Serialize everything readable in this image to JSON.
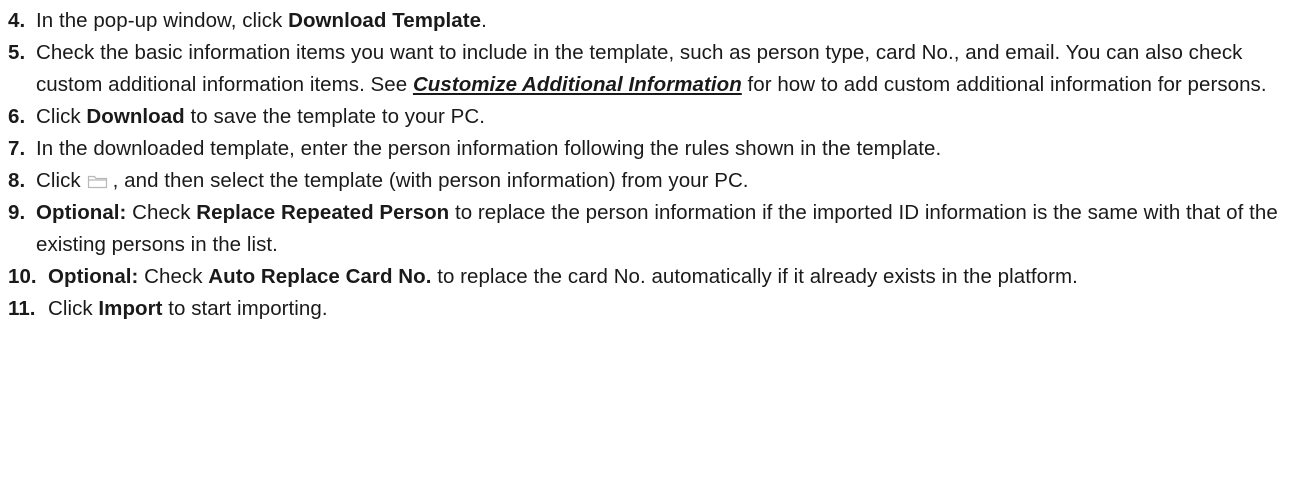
{
  "steps": [
    {
      "num": "4.",
      "t1": "In the pop-up window, click ",
      "b1": "Download Template",
      "t2": "."
    },
    {
      "num": "5.",
      "t1": "Check the basic information items you want to include in the template, such as person type, card No., and email. You can also check custom additional information items. See ",
      "link": "Customize Additional Information",
      "t2": " for how to add custom additional information for persons."
    },
    {
      "num": "6.",
      "t1": "Click ",
      "b1": "Download",
      "t2": " to save the template to your PC."
    },
    {
      "num": "7.",
      "t1": "In the downloaded template, enter the person information following the rules shown in the template."
    },
    {
      "num": "8.",
      "t1": "Click",
      "icon": "folder-icon",
      "t2": ", and then select the template (with person information) from your PC."
    },
    {
      "num": "9.",
      "b0": "Optional:",
      "t1": " Check ",
      "b1": "Replace Repeated Person",
      "t2": " to replace the person information if the imported ID information is the same with that of the existing persons in the list."
    },
    {
      "num": "10.",
      "b0": "Optional:",
      "t1": " Check ",
      "b1": "Auto Replace Card No.",
      "t2": " to replace the card No. automatically if it already exists in the platform."
    },
    {
      "num": "11.",
      "t1": "Click ",
      "b1": "Import",
      "t2": " to start importing."
    }
  ],
  "colors": {
    "text": "#1a1a1a",
    "icon_stroke": "#b8b8b8"
  }
}
